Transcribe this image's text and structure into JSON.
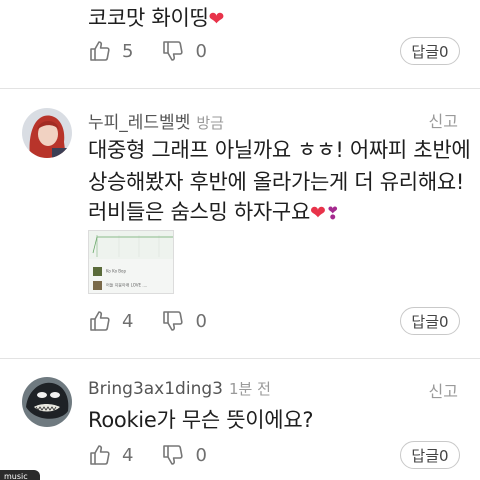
{
  "comments": [
    {
      "text_lines": [
        "코코맛 화이띵"
      ],
      "likes": "5",
      "dislikes": "0",
      "reply_label": "답글0"
    },
    {
      "author": "누피_레드벨벳",
      "time": "방금",
      "report_label": "신고",
      "text_lines": [
        "대중형 그래프 아닐까요 ㅎㅎ! 어짜피 초반에",
        "상승해봤자 후반에 올라가는게 더 유리해요!",
        "러비들은 숨스밍 하자구요"
      ],
      "attachment_rows": [
        "Ko Ko Bop",
        "어둘 지붕아래 LOVE ...."
      ],
      "likes": "4",
      "dislikes": "0",
      "reply_label": "답글0"
    },
    {
      "author": "Bring3ax1ding3",
      "time": "1분 전",
      "report_label": "신고",
      "text_lines": [
        "Rookie가 무슨 뜻이에요?"
      ],
      "likes": "4",
      "dislikes": "0",
      "reply_label": "답글0"
    }
  ],
  "bottom_tag": "music",
  "colors": {
    "heart": "#e8334a",
    "divider": "#e3e3e3",
    "muted": "#9a9a9a"
  },
  "icons": [
    "thumbs-up-icon",
    "thumbs-down-icon",
    "heart-icon",
    "sparkle-heart-icon"
  ]
}
